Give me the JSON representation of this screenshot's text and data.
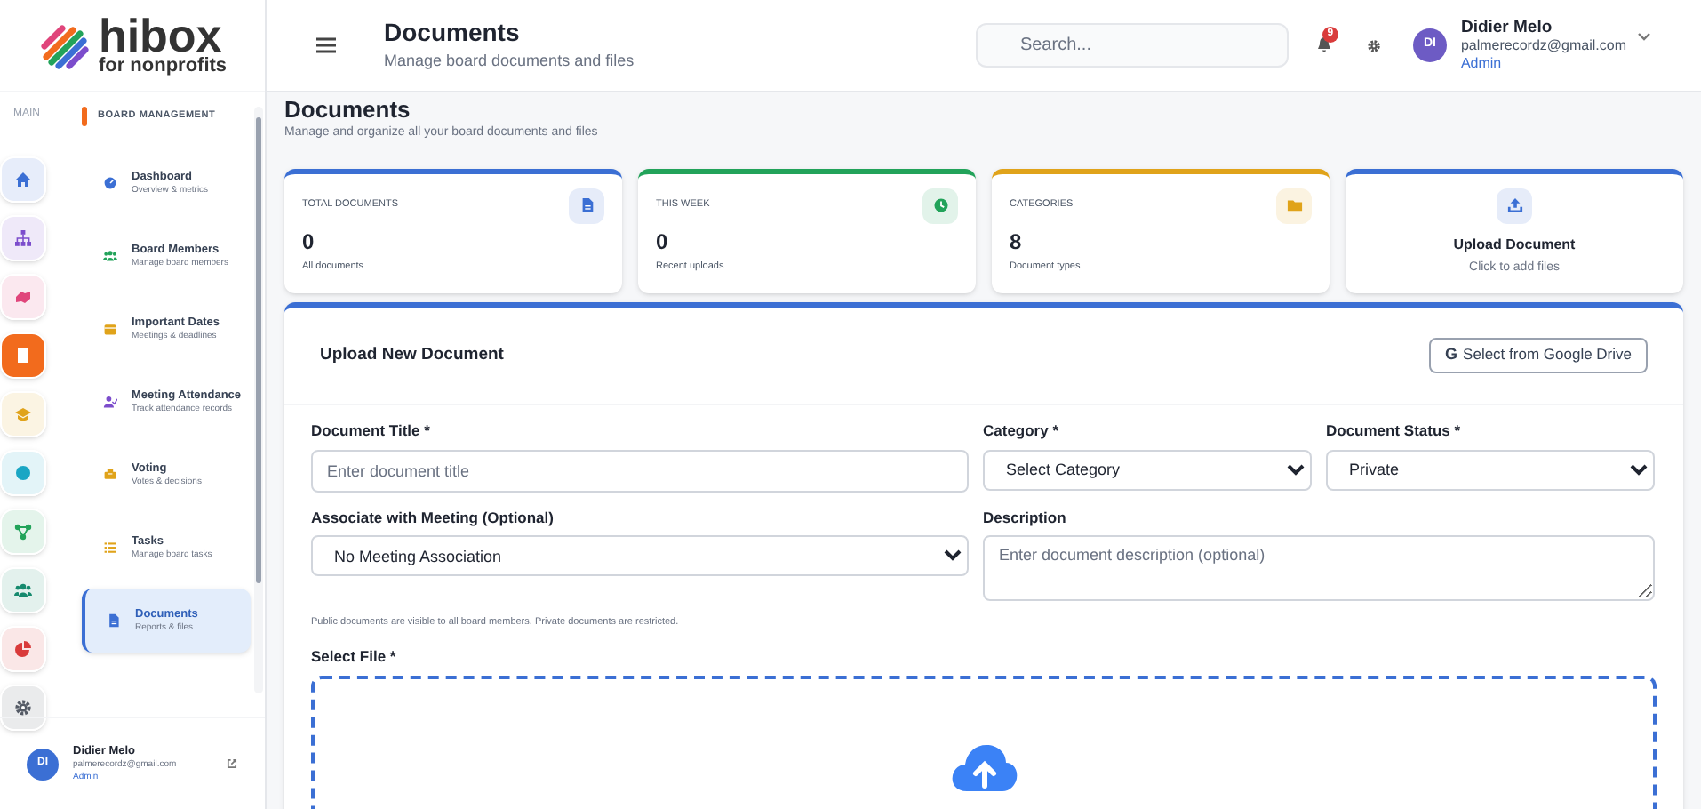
{
  "logo": {
    "name": "hibox",
    "tagline": "for nonprofits"
  },
  "rail": {
    "label": "MAIN",
    "items": [
      {
        "color": "#3b6fd4",
        "selected": false
      },
      {
        "color": "#7c4dcc",
        "selected": false
      },
      {
        "color": "#e0457b",
        "selected": false
      },
      {
        "color": "#f26b1d",
        "selected": true
      },
      {
        "color": "#e0a31a",
        "selected": false
      },
      {
        "color": "#1aa6c4",
        "selected": false
      },
      {
        "color": "#22a35a",
        "selected": false
      },
      {
        "color": "#168a6e",
        "selected": false
      },
      {
        "color": "#d93b3b",
        "selected": false
      },
      {
        "color": "#555b66",
        "selected": false
      }
    ]
  },
  "sidebar": {
    "section": "BOARD MANAGEMENT",
    "items": [
      {
        "color": "#3b6fd4",
        "title": "Dashboard",
        "subtitle": "Overview & metrics",
        "selected": false
      },
      {
        "color": "#22a35a",
        "title": "Board Members",
        "subtitle": "Manage board members",
        "selected": false
      },
      {
        "color": "#e0a31a",
        "title": "Important Dates",
        "subtitle": "Meetings & deadlines",
        "selected": false
      },
      {
        "color": "#7c4dcc",
        "title": "Meeting Attendance",
        "subtitle": "Track attendance records",
        "selected": false
      },
      {
        "color": "#e0a31a",
        "title": "Voting",
        "subtitle": "Votes & decisions",
        "selected": false
      },
      {
        "color": "#e0a31a",
        "title": "Tasks",
        "subtitle": "Manage board tasks",
        "selected": false
      },
      {
        "color": "#3b6fd4",
        "title": "Documents",
        "subtitle": "Reports & files",
        "selected": true
      }
    ]
  },
  "user_footer": {
    "initials": "DI",
    "name": "Didier Melo",
    "email": "palmerecordz@gmail.com",
    "role": "Admin"
  },
  "header": {
    "title": "Documents",
    "subtitle": "Manage board documents and files",
    "search_placeholder": "Search...",
    "notification_count": "9",
    "user": {
      "initials": "DI",
      "name": "Didier Melo",
      "email": "palmerecordz@gmail.com",
      "role": "Admin"
    }
  },
  "page": {
    "title": "Documents",
    "subtitle": "Manage and organize all your board documents and files"
  },
  "stats": [
    {
      "kind": "stat",
      "label": "TOTAL DOCUMENTS",
      "value": "0",
      "note": "All documents",
      "color": "#3b6fd4"
    },
    {
      "kind": "stat",
      "label": "THIS WEEK",
      "value": "0",
      "note": "Recent uploads",
      "color": "#22a35a"
    },
    {
      "kind": "stat",
      "label": "CATEGORIES",
      "value": "8",
      "note": "Document types",
      "color": "#e0a31a"
    },
    {
      "kind": "action",
      "label": "Upload Document",
      "note": "Click to add files",
      "color": "#3b6fd4"
    }
  ],
  "upload_form": {
    "title": "Upload New Document",
    "drive_button": "Select from Google Drive",
    "drive_glyph": "G",
    "fields": [
      {
        "kind": "input",
        "label": "Document Title *",
        "placeholder": "Enter document title"
      },
      {
        "kind": "select",
        "label": "Category *",
        "value": "Select Category"
      },
      {
        "kind": "select",
        "label": "Document Status *",
        "value": "Private"
      },
      {
        "kind": "select",
        "label": "Associate with Meeting (Optional)",
        "value": "No Meeting Association"
      },
      {
        "kind": "textarea",
        "label": "Description",
        "placeholder": "Enter document description (optional)"
      }
    ],
    "hint": "Public documents are visible to all board members. Private documents are restricted.",
    "file_label": "Select File *"
  }
}
